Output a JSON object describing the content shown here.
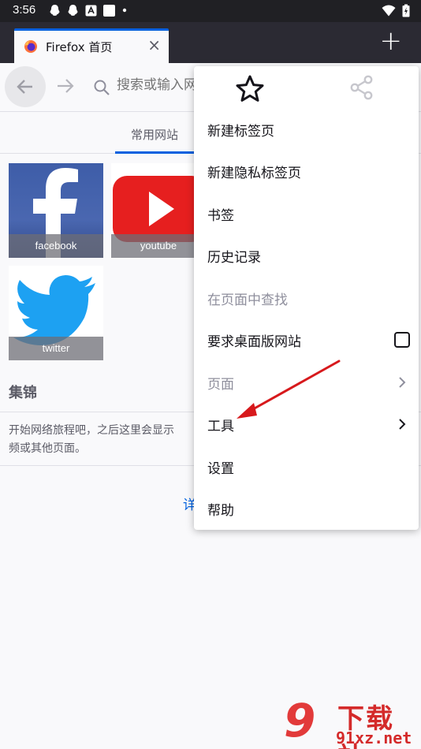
{
  "status_bar": {
    "time": "3:56"
  },
  "tab": {
    "title": "Firefox 首页",
    "close": "×",
    "new_tab": "+"
  },
  "toolbar": {
    "search_placeholder": "搜索或输入网址"
  },
  "home": {
    "section_tab": "常用网站",
    "tiles": [
      {
        "label": "facebook"
      },
      {
        "label": "youtube"
      },
      {
        "label": "twitter"
      }
    ],
    "collections_title": "集锦",
    "collections_desc_line1": "开始网络旅程吧，之后这里会显示",
    "collections_desc_line2": "频或其他页面。",
    "learn_more": "详"
  },
  "menu": {
    "items": [
      {
        "label": "新建标签页"
      },
      {
        "label": "新建隐私标签页"
      },
      {
        "label": "书签"
      },
      {
        "label": "历史记录"
      },
      {
        "label": "在页面中查找"
      },
      {
        "label": "要求桌面版网站"
      },
      {
        "label": "页面"
      },
      {
        "label": "工具"
      },
      {
        "label": "设置"
      },
      {
        "label": "帮助"
      }
    ]
  },
  "watermark": {
    "mark": "9",
    "title": "下载站",
    "site": "91xz.net"
  },
  "colors": {
    "accent": "#0060df",
    "annotation_arrow": "#d7191c"
  }
}
